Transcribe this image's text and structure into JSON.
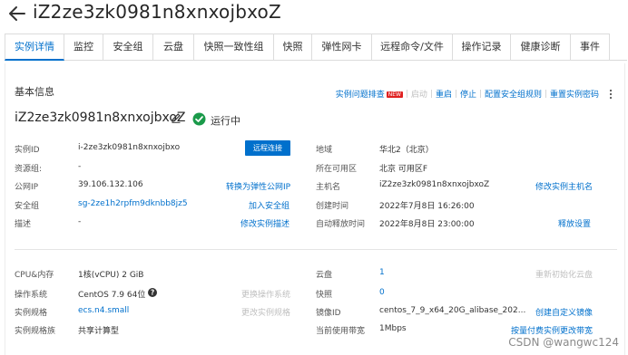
{
  "header": {
    "title": "iZ2ze3zk0981n8xnxojbxoZ"
  },
  "tabs": [
    {
      "label": "实例详情",
      "active": true
    },
    {
      "label": "监控"
    },
    {
      "label": "安全组"
    },
    {
      "label": "云盘"
    },
    {
      "label": "快照一致性组"
    },
    {
      "label": "快照"
    },
    {
      "label": "弹性网卡"
    },
    {
      "label": "远程命令/文件"
    },
    {
      "label": "操作记录"
    },
    {
      "label": "健康诊断"
    },
    {
      "label": "事件"
    }
  ],
  "basic": {
    "section_title": "基本信息",
    "actions": {
      "diagnose": "实例问题排查",
      "new_badge": "NEW",
      "start": "启动",
      "restart": "重启",
      "stop": "停止",
      "security_rules": "配置安全组规则",
      "reset_password": "重置实例密码"
    },
    "instance_name": "iZ2ze3zk0981n8xnxojbxoZ",
    "status": "运行中",
    "fields": {
      "instance_id_label": "实例ID",
      "instance_id_value": "i-2ze3zk0981n8xnxojbxo",
      "remote_connect": "远程连接",
      "resource_group_label": "资源组:",
      "resource_group_value": "-",
      "public_ip_label": "公网IP",
      "public_ip_value": "39.106.132.106",
      "convert_eip": "转换为弹性公网IP",
      "security_group_label": "安全组",
      "security_group_value": "sg-2ze1h2rpfm9dknbb8jz5",
      "join_sg": "加入安全组",
      "description_label": "描述",
      "description_value": "-",
      "modify_description": "修改实例描述",
      "region_label": "地域",
      "region_value": "华北2（北京）",
      "zone_label": "所在可用区",
      "zone_value": "北京 可用区F",
      "hostname_label": "主机名",
      "hostname_value": "iZ2ze3zk0981n8xnxojbxoZ",
      "modify_hostname": "修改实例主机名",
      "created_label": "创建时间",
      "created_value": "2022年7月8日 16:26:00",
      "auto_release_label": "自动释放时间",
      "auto_release_value": "2022年8月8日 23:00:00",
      "release_settings": "释放设置"
    }
  },
  "config": {
    "cpu_mem_label": "CPU&内存",
    "cpu_mem_value": "1核(vCPU) 2 GiB",
    "os_label": "操作系统",
    "os_value": "CentOS 7.9 64位",
    "change_os": "更换操作系统",
    "spec_label": "实例规格",
    "spec_value": "ecs.n4.small",
    "change_spec": "更改实例规格",
    "family_label": "实例规格族",
    "family_value": "共享计算型",
    "disk_label": "云盘",
    "disk_value": "1",
    "reinit_disk": "重新初始化云盘",
    "snapshot_label": "快照",
    "snapshot_value": "0",
    "image_label": "镜像ID",
    "image_value": "centos_7_9_x64_20G_alibase_202...",
    "create_image": "创建自定义镜像",
    "bandwidth_label": "当前使用带宽",
    "bandwidth_value": "1Mbps",
    "change_bandwidth": "按量付费实例更改带宽"
  },
  "watermark": "CSDN @wangwc124",
  "colors": {
    "accent": "#0070cc",
    "status_ok": "#1a9a4a",
    "disabled": "#bfbfbf"
  }
}
